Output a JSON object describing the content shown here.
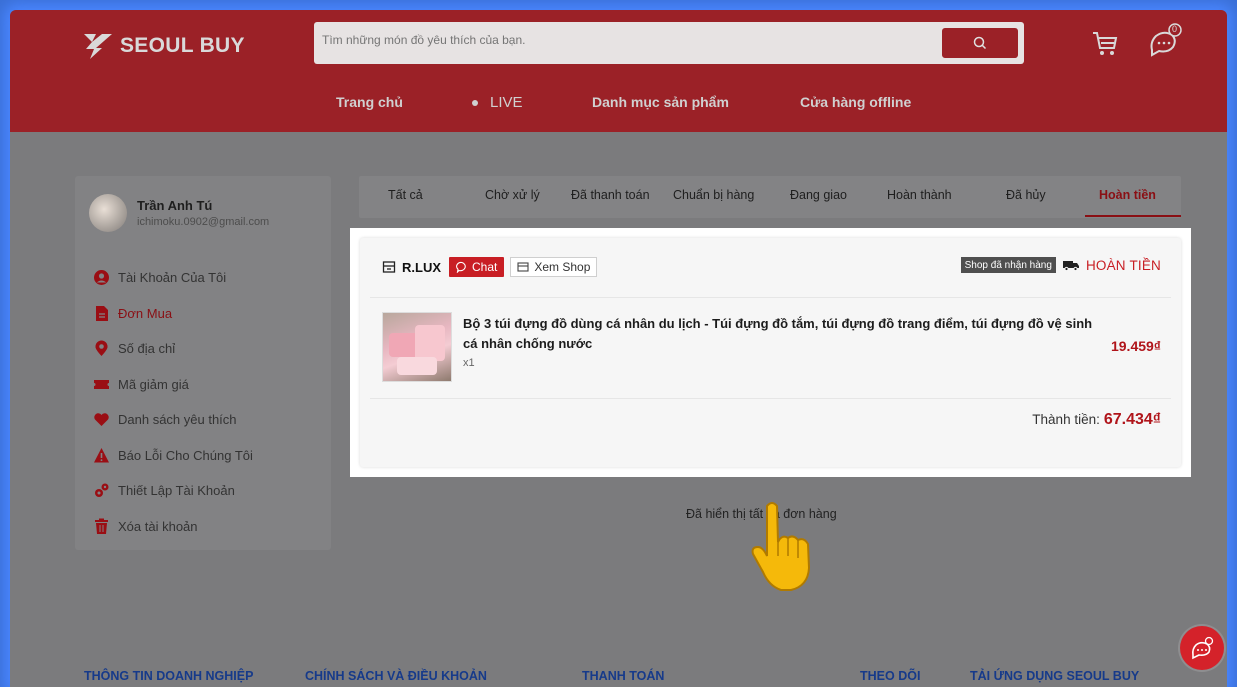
{
  "header": {
    "brand": "SEOUL BUY",
    "search_placeholder": "Tìm những món đồ yêu thích của bạn.",
    "notification_count": "0",
    "nav": [
      "Trang chủ",
      "LIVE",
      "Danh mục sản phẩm",
      "Cửa hàng offline"
    ]
  },
  "profile": {
    "name": "Trần Anh Tú",
    "email": "ichimoku.0902@gmail.com"
  },
  "sidebar": {
    "items": [
      {
        "label": "Tài Khoản Của Tôi",
        "icon": "user-circle-icon"
      },
      {
        "label": "Đơn Mua",
        "icon": "document-icon"
      },
      {
        "label": "Số địa chỉ",
        "icon": "location-pin-icon"
      },
      {
        "label": "Mã giảm giá",
        "icon": "ticket-icon"
      },
      {
        "label": "Danh sách yêu thích",
        "icon": "heart-icon"
      },
      {
        "label": "Báo Lỗi Cho Chúng Tôi",
        "icon": "warning-icon"
      },
      {
        "label": "Thiết Lập Tài Khoản",
        "icon": "settings-icon"
      },
      {
        "label": "Xóa tài khoản",
        "icon": "trash-icon"
      }
    ]
  },
  "tabs": [
    "Tất cả",
    "Chờ xử lý",
    "Đã thanh toán",
    "Chuẩn bị hàng",
    "Đang giao",
    "Hoàn thành",
    "Đã hủy",
    "Hoàn tiền"
  ],
  "order": {
    "shop_name": "R.LUX",
    "chat_label": "Chat",
    "view_shop_label": "Xem Shop",
    "status_badge": "Shop đã nhận hàng",
    "status": "HOÀN TIỀN",
    "product_name": "Bộ 3 túi đựng đồ dùng cá nhân du lịch - Túi đựng đồ tắm, túi đựng đồ trang điểm, túi đựng đồ vệ sinh cá nhân chống nước",
    "quantity": "x1",
    "price": "19.459₫",
    "total_label": "Thành tiền:",
    "total_value": "67.434₫"
  },
  "all_shown_text": "Đã hiển thị tất cả đơn hàng",
  "footer": [
    "THÔNG TIN DOANH NGHIỆP",
    "CHÍNH SÁCH VÀ ĐIỀU KHOẢN",
    "THANH TOÁN",
    "THEO DÕI",
    "TẢI ỨNG DỤNG SEOUL BUY"
  ],
  "colors": {
    "brand_red": "#9b2127",
    "accent_red": "#c81e24",
    "footer_blue": "#163a8a"
  }
}
